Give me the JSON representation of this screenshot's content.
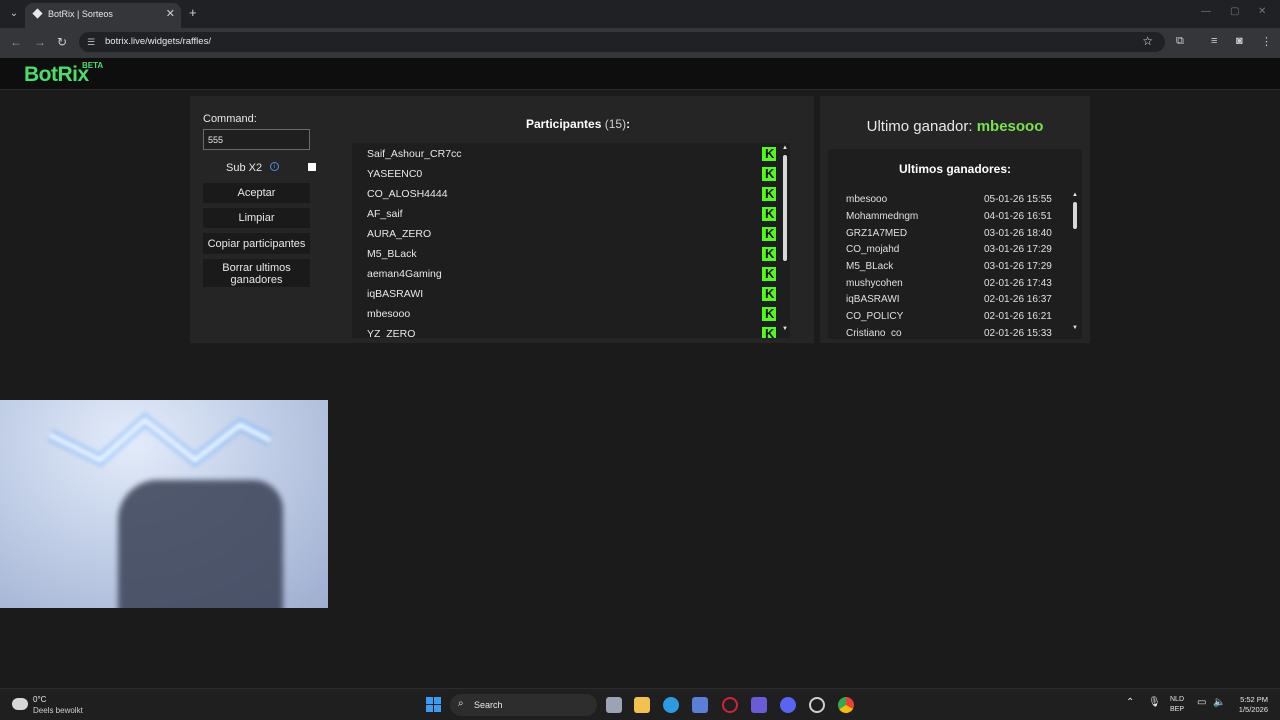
{
  "browser": {
    "tab_title": "BotRix | Sorteos",
    "url": "botrix.live/widgets/raffles/",
    "new_tab": "+",
    "tab_close": "✕"
  },
  "site": {
    "logo": "BotRix",
    "logo_badge": "BETA"
  },
  "raffle": {
    "command_label": "Command:",
    "command_value": "555",
    "sub_x2_label": "Sub X2",
    "sub_x2_checked": false,
    "buttons": {
      "accept": "Aceptar",
      "clear": "Limpiar",
      "copy": "Copiar participantes",
      "delete_winners_line1": "Borrar ultimos",
      "delete_winners_line2": "ganadores"
    },
    "participants_title": "Participantes",
    "participants_count": "(15)",
    "participants_suffix": ":",
    "participants": [
      "Saif_Ashour_CR7cc",
      "YASEENC0",
      "CO_ALOSH4444",
      "AF_saif",
      "AURA_ZERO",
      "M5_BLack",
      "aeman4Gaming",
      "iqBASRAWI",
      "mbesooo",
      "YZ_ZERO"
    ],
    "platform_icon_glyph": "K",
    "participants_scroll_fraction": 0.33
  },
  "winners": {
    "last_winner_label": "Ultimo ganador:",
    "last_winner_name": "mbesooo",
    "title": "Ultimos ganadores:",
    "list": [
      {
        "name": "mbesooo",
        "date": "05-01-26 15:55"
      },
      {
        "name": "Mohammedngm",
        "date": "04-01-26 16:51"
      },
      {
        "name": "GRZ1A7MED",
        "date": "03-01-26 18:40"
      },
      {
        "name": "CO_mojahd",
        "date": "03-01-26 17:29"
      },
      {
        "name": "M5_BLack",
        "date": "03-01-26 17:29"
      },
      {
        "name": "mushycohen",
        "date": "02-01-26 17:43"
      },
      {
        "name": "iqBASRAWI",
        "date": "02-01-26 16:37"
      },
      {
        "name": "CO_POLICY",
        "date": "02-01-26 16:21"
      },
      {
        "name": "Cristiano_co",
        "date": "02-01-26 15:33"
      }
    ]
  },
  "taskbar": {
    "temperature": "0°C",
    "weather": "Deels bewolkt",
    "search": "Search",
    "lang_line1": "NLD",
    "lang_line2": "BEP",
    "time": "5:52 PM",
    "date": "1/5/2026"
  },
  "colors": {
    "accent_green": "#4ade6a",
    "kick_green": "#53fc18",
    "winner_green": "#7be04a"
  }
}
